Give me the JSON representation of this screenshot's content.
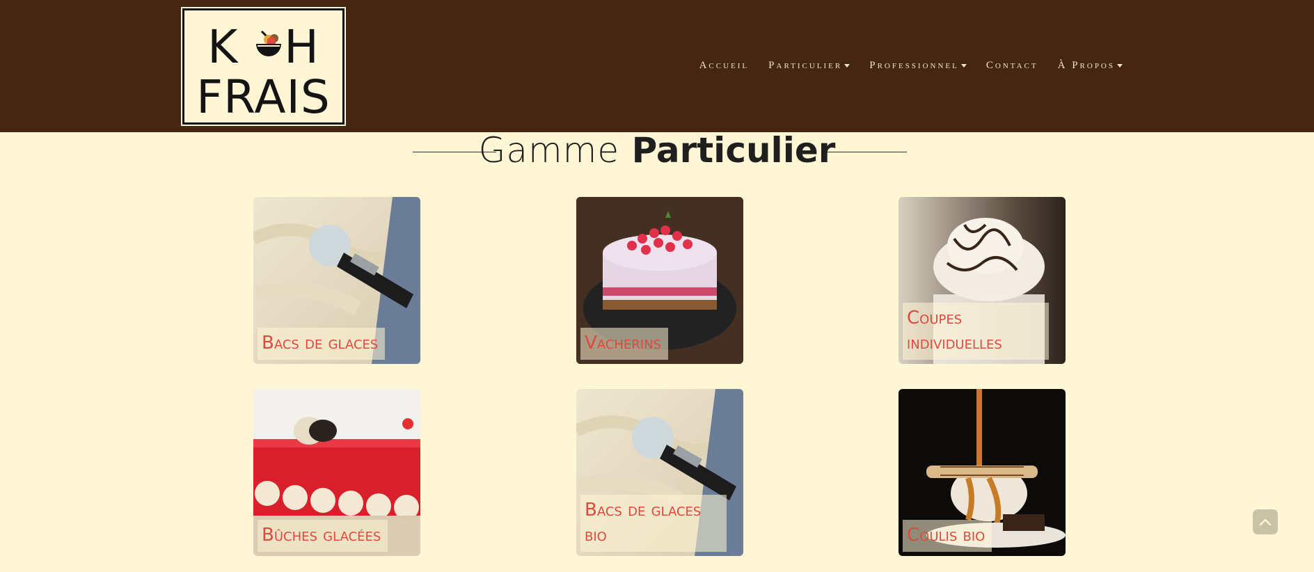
{
  "logo": {
    "line1": "K H",
    "line2": "FRAIS",
    "brand_colors": {
      "orange": "#e8a63a",
      "brown": "#8a5a33",
      "red": "#e0493d",
      "ink": "#141414"
    }
  },
  "nav": {
    "items": [
      {
        "label": "Accueil",
        "dropdown": false
      },
      {
        "label": "Particulier",
        "dropdown": true
      },
      {
        "label": "Professionnel",
        "dropdown": true
      },
      {
        "label": "Contact",
        "dropdown": false
      },
      {
        "label": "À Propos",
        "dropdown": true
      }
    ]
  },
  "section": {
    "title_light": "Gamme",
    "title_bold": "Particulier"
  },
  "products": [
    {
      "label": "Bacs de glaces",
      "icon": "ice-cream-scoop-photo"
    },
    {
      "label": "Vacherins",
      "icon": "raspberry-cake-photo"
    },
    {
      "label": "Coupes individuelles",
      "icon": "whipped-cream-cup-photo"
    },
    {
      "label": "Bûches glacées",
      "icon": "red-log-cake-photo"
    },
    {
      "label": "Bacs de glaces bio",
      "icon": "ice-cream-scoop-photo"
    },
    {
      "label": "Coulis bio",
      "icon": "caramel-coulis-photo"
    }
  ],
  "back_to_top": {
    "icon": "chevron-up-icon"
  },
  "colors": {
    "header_bg": "#452613",
    "page_bg": "#fff6d6",
    "nav_text": "#f4e3c1",
    "card_label": "#e0493d"
  }
}
